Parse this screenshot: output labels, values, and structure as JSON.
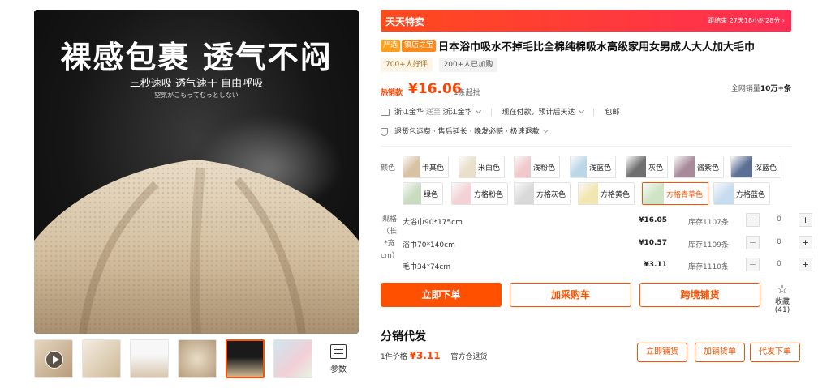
{
  "gallery": {
    "hero_title": "裸感包裹 透气不闷",
    "hero_subtitle": "三秒速吸 透气速干 自由呼吸",
    "hero_caption": "空気がこもってむっとしない",
    "params_label": "参数"
  },
  "promo": {
    "title": "天天特卖",
    "timer": "距结束 27天18小时28分 ›"
  },
  "product": {
    "tag_yan": "严选",
    "tag_store": "镇店之宝",
    "title": "日本浴巾吸水不掉毛比全棉纯棉吸水高级家用女男成人大人加大毛巾",
    "badge_good": "700+人好评",
    "badge_buy": "200+人已加购"
  },
  "price": {
    "label": "热销款",
    "value": "¥16.06",
    "min_order": "1条起批",
    "sales_prefix": "全网销量",
    "sales_value": "10万+条"
  },
  "shipping": {
    "from": "浙江金华",
    "send_to_label": "送至",
    "to": "浙江金华",
    "payment": "现在付款，预计后天达",
    "freight": "包邮"
  },
  "services": {
    "text": "退货包运费 · 售后延长 · 晚发必赔 · 极速退款"
  },
  "colors": {
    "label": "颜色",
    "items": [
      {
        "name": "卡其色",
        "color": "#d8c2a2"
      },
      {
        "name": "米白色",
        "color": "#eadfc8"
      },
      {
        "name": "浅粉色",
        "color": "#f1c9cc"
      },
      {
        "name": "浅蓝色",
        "color": "#bcd6e8"
      },
      {
        "name": "灰色",
        "color": "#6f6f6f"
      },
      {
        "name": "酱紫色",
        "color": "#a98a9a"
      },
      {
        "name": "深蓝色",
        "color": "#5c7096"
      },
      {
        "name": "绿色",
        "color": "#c9dcc0"
      },
      {
        "name": "方格粉色",
        "color": "#f3d2d6"
      },
      {
        "name": "方格灰色",
        "color": "#d9d9d9"
      },
      {
        "name": "方格黄色",
        "color": "#f1e6b0"
      },
      {
        "name": "方格青草色",
        "color": "#cfe3c6"
      },
      {
        "name": "方格蓝色",
        "color": "#c8dcf0"
      }
    ]
  },
  "specs": {
    "label": "规格（长*宽cm）",
    "rows": [
      {
        "name": "大浴巾90*175cm",
        "price": "¥16.05",
        "stock": "库存1107条",
        "qty": "0"
      },
      {
        "name": "浴巾70*140cm",
        "price": "¥10.57",
        "stock": "库存1109条",
        "qty": "0"
      },
      {
        "name": "毛巾34*74cm",
        "price": "¥3.11",
        "stock": "库存1110条",
        "qty": "0"
      }
    ]
  },
  "actions": {
    "order": "立即下单",
    "cart": "加采购车",
    "cross_border": "跨境铺货",
    "favorite": "收藏 (41)"
  },
  "distribution": {
    "title": "分销代发",
    "price_prefix": "1件价格",
    "price": "¥3.11",
    "warehouse": "官方仓退货",
    "btn_list": "立即铺货",
    "btn_add": "加铺货单",
    "btn_order": "代发下单"
  }
}
